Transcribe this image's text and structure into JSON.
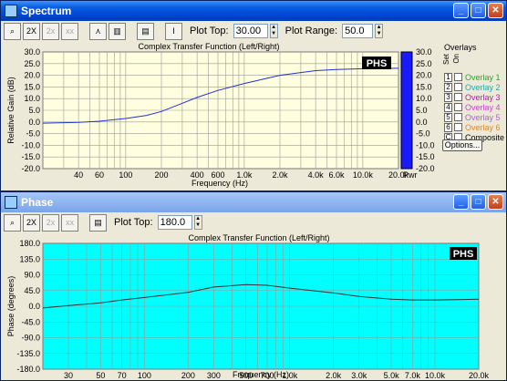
{
  "spectrum": {
    "title": "Spectrum",
    "tools": {
      "zoom": "🔍",
      "onx": "On\n2X",
      "curr1": "Curr\n2x",
      "curr2": "Curr\n2xx"
    },
    "plot_top_label": "Plot Top:",
    "plot_top_value": "30.00",
    "plot_range_label": "Plot Range:",
    "plot_range_value": "50.0",
    "chart_title": "Complex Transfer Function (Left/Right)",
    "ylabel": "Relative Gain (dB)",
    "xlabel": "Frequency (Hz)",
    "logo": "PHS",
    "pwr_label": "Pwr",
    "overlays_title": "Overlays",
    "set_label": "Set",
    "on_label": "On",
    "overlays": [
      {
        "num": "1",
        "label": "Overlay 1",
        "color": "#22aa22"
      },
      {
        "num": "2",
        "label": "Overlay 2",
        "color": "#22aaaa"
      },
      {
        "num": "3",
        "label": "Overlay 3",
        "color": "#aa22aa"
      },
      {
        "num": "4",
        "label": "Overlay 4",
        "color": "#cc44cc"
      },
      {
        "num": "5",
        "label": "Overlay 5",
        "color": "#aa66cc"
      },
      {
        "num": "6",
        "label": "Overlay 6",
        "color": "#dd8833"
      },
      {
        "num": "C",
        "label": "Composite",
        "color": "#000000"
      }
    ],
    "options_label": "Options...",
    "yticks": [
      "30.0",
      "25.0",
      "20.0",
      "15.0",
      "10.0",
      "5.0",
      "0.0",
      "-5.0",
      "-10.0",
      "-15.0",
      "-20.0"
    ],
    "pwr_ticks": [
      "30.0",
      "25.0",
      "20.0",
      "15.0",
      "10.0",
      "5.0",
      "0.0",
      "-5.0",
      "-10.0",
      "-15.0",
      "-20.0"
    ],
    "xticks": [
      "40",
      "60",
      "100",
      "200",
      "400",
      "600",
      "1.0k",
      "2.0k",
      "4.0k",
      "6.0k",
      "10.0k",
      "20.0k"
    ]
  },
  "phase": {
    "title": "Phase",
    "plot_top_label": "Plot Top:",
    "plot_top_value": "180.0",
    "chart_title": "Complex Transfer Function (Left/Right)",
    "ylabel": "Phase (degrees)",
    "xlabel": "Frequency (Hz)",
    "logo": "PHS",
    "yticks": [
      "180.0",
      "135.0",
      "90.0",
      "45.0",
      "0.0",
      "-45.0",
      "-90.0",
      "-135.0",
      "-180.0"
    ],
    "xticks": [
      "30",
      "50",
      "70",
      "100",
      "200",
      "300",
      "500",
      "700",
      "1.0k",
      "2.0k",
      "3.0k",
      "5.0k",
      "7.0k",
      "10.0k",
      "20.0k"
    ]
  },
  "chart_data": [
    {
      "type": "line",
      "title": "Complex Transfer Function (Left/Right)",
      "xlabel": "Frequency (Hz)",
      "ylabel": "Relative Gain (dB)",
      "xscale": "log",
      "xlim": [
        20,
        20000
      ],
      "ylim": [
        -20,
        30
      ],
      "grid": true,
      "series": [
        {
          "x": [
            20,
            40,
            60,
            100,
            150,
            200,
            300,
            400,
            600,
            1000,
            2000,
            4000,
            6000,
            10000,
            20000
          ],
          "y": [
            -0.5,
            -0.2,
            0.3,
            1.5,
            2.8,
            4.5,
            8,
            10.5,
            13.5,
            16.5,
            20,
            22,
            22.5,
            22.8,
            23
          ]
        }
      ]
    },
    {
      "type": "line",
      "title": "Complex Transfer Function (Left/Right)",
      "xlabel": "Frequency (Hz)",
      "ylabel": "Phase (degrees)",
      "xscale": "log",
      "xlim": [
        20,
        20000
      ],
      "ylim": [
        -180,
        180
      ],
      "grid": true,
      "series": [
        {
          "x": [
            20,
            30,
            50,
            70,
            100,
            200,
            300,
            500,
            700,
            1000,
            2000,
            3000,
            5000,
            7000,
            10000,
            20000
          ],
          "y": [
            -5,
            2,
            10,
            18,
            25,
            40,
            55,
            62,
            60,
            52,
            38,
            28,
            20,
            18,
            18,
            20
          ]
        }
      ]
    }
  ]
}
